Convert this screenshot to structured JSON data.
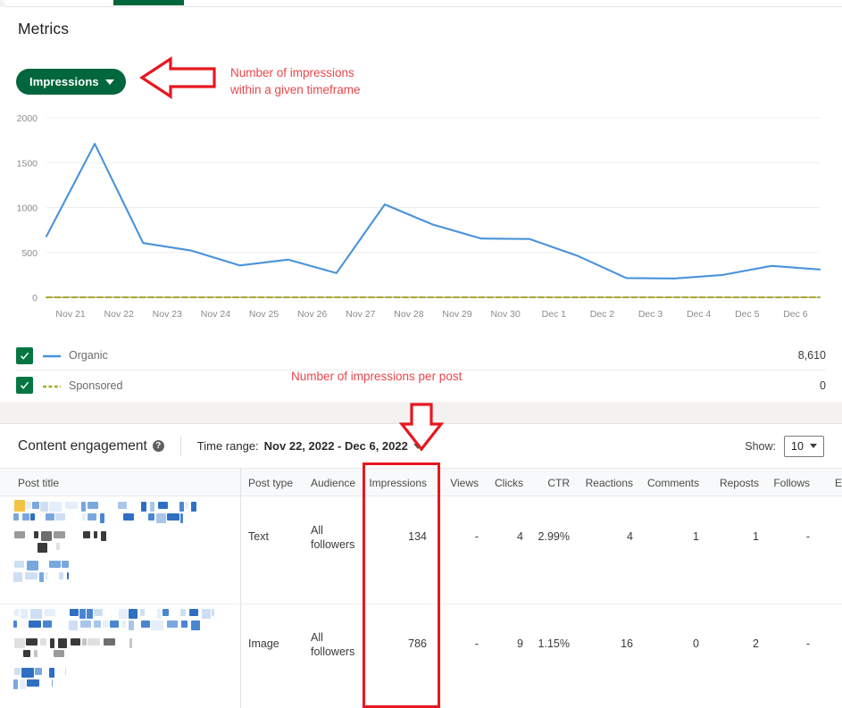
{
  "tabstrip": {
    "active_tab_indicator": "analytics-tab"
  },
  "metrics": {
    "title": "Metrics",
    "metric_selector_label": "Impressions",
    "caret_icon": "chevron-down-icon"
  },
  "annotations": {
    "impressions_note": "Number of impressions\nwithin a given timeframe",
    "per_post_note": "Number of impressions per post",
    "color": "#e8474a",
    "box_color": "#e8171f",
    "left_arrow_icon": "arrow-left-annotation",
    "down_arrow_icon": "arrow-down-annotation",
    "highlight_box_icon": "rectangle-highlight-annotation"
  },
  "chart_data": {
    "type": "line",
    "title": "",
    "xlabel": "",
    "ylabel": "",
    "ylim": [
      0,
      2000
    ],
    "yticks": [
      0,
      500,
      1000,
      1500,
      2000
    ],
    "ytick_labels": [
      "0",
      "500",
      "1000",
      "1500",
      "2000"
    ],
    "grid": true,
    "legend_position": "below",
    "categories": [
      "Nov 21",
      "Nov 22",
      "Nov 23",
      "Nov 24",
      "Nov 25",
      "Nov 26",
      "Nov 27",
      "Nov 28",
      "Nov 29",
      "Nov 30",
      "Dec 1",
      "Dec 2",
      "Dec 3",
      "Dec 4",
      "Dec 5",
      "Dec 6"
    ],
    "series": [
      {
        "name": "Organic",
        "color": "#4a93d9",
        "style": "solid",
        "total": "8,610",
        "values": [
          680,
          1710,
          605,
          520,
          355,
          420,
          270,
          1035,
          810,
          655,
          650,
          460,
          215,
          210,
          250,
          350,
          310
        ]
      },
      {
        "name": "Sponsored",
        "color": "#a8a82e",
        "style": "dashed",
        "total": "0",
        "values": [
          0,
          0,
          0,
          0,
          0,
          0,
          0,
          0,
          0,
          0,
          0,
          0,
          0,
          0,
          0,
          0,
          0
        ]
      }
    ]
  },
  "legend": {
    "rows": [
      {
        "label": "Organic",
        "value": "8,610",
        "style": "solid",
        "color": "#4a93d9",
        "checked": true
      },
      {
        "label": "Sponsored",
        "value": "0",
        "style": "dashed",
        "color": "#a8a82e",
        "checked": true
      }
    ],
    "checkbox_icon": "checkmark-icon"
  },
  "content_engagement": {
    "title": "Content engagement",
    "help_icon": "question-mark-icon",
    "time_range_label": "Time range:",
    "time_range_value": "Nov 22, 2022 - Dec 6, 2022",
    "time_range_caret_icon": "chevron-down-icon",
    "show_label": "Show:",
    "show_value": "10",
    "show_caret_icon": "chevron-down-icon"
  },
  "table": {
    "columns": [
      "Post title",
      "Post type",
      "Audience",
      "Impressions",
      "Views",
      "Clicks",
      "CTR",
      "Reactions",
      "Comments",
      "Reposts",
      "Follows",
      "E"
    ],
    "rows": [
      {
        "post_title": "",
        "post_type": "Text",
        "audience_line1": "All",
        "audience_line2": "followers",
        "impressions": "134",
        "views": "-",
        "clicks": "4",
        "ctr": "2.99%",
        "reactions": "4",
        "comments": "1",
        "reposts": "1",
        "follows": "-"
      },
      {
        "post_title": "",
        "post_type": "Image",
        "audience_line1": "All",
        "audience_line2": "followers",
        "impressions": "786",
        "views": "-",
        "clicks": "9",
        "ctr": "1.15%",
        "reactions": "16",
        "comments": "0",
        "reposts": "2",
        "follows": "-"
      }
    ]
  }
}
